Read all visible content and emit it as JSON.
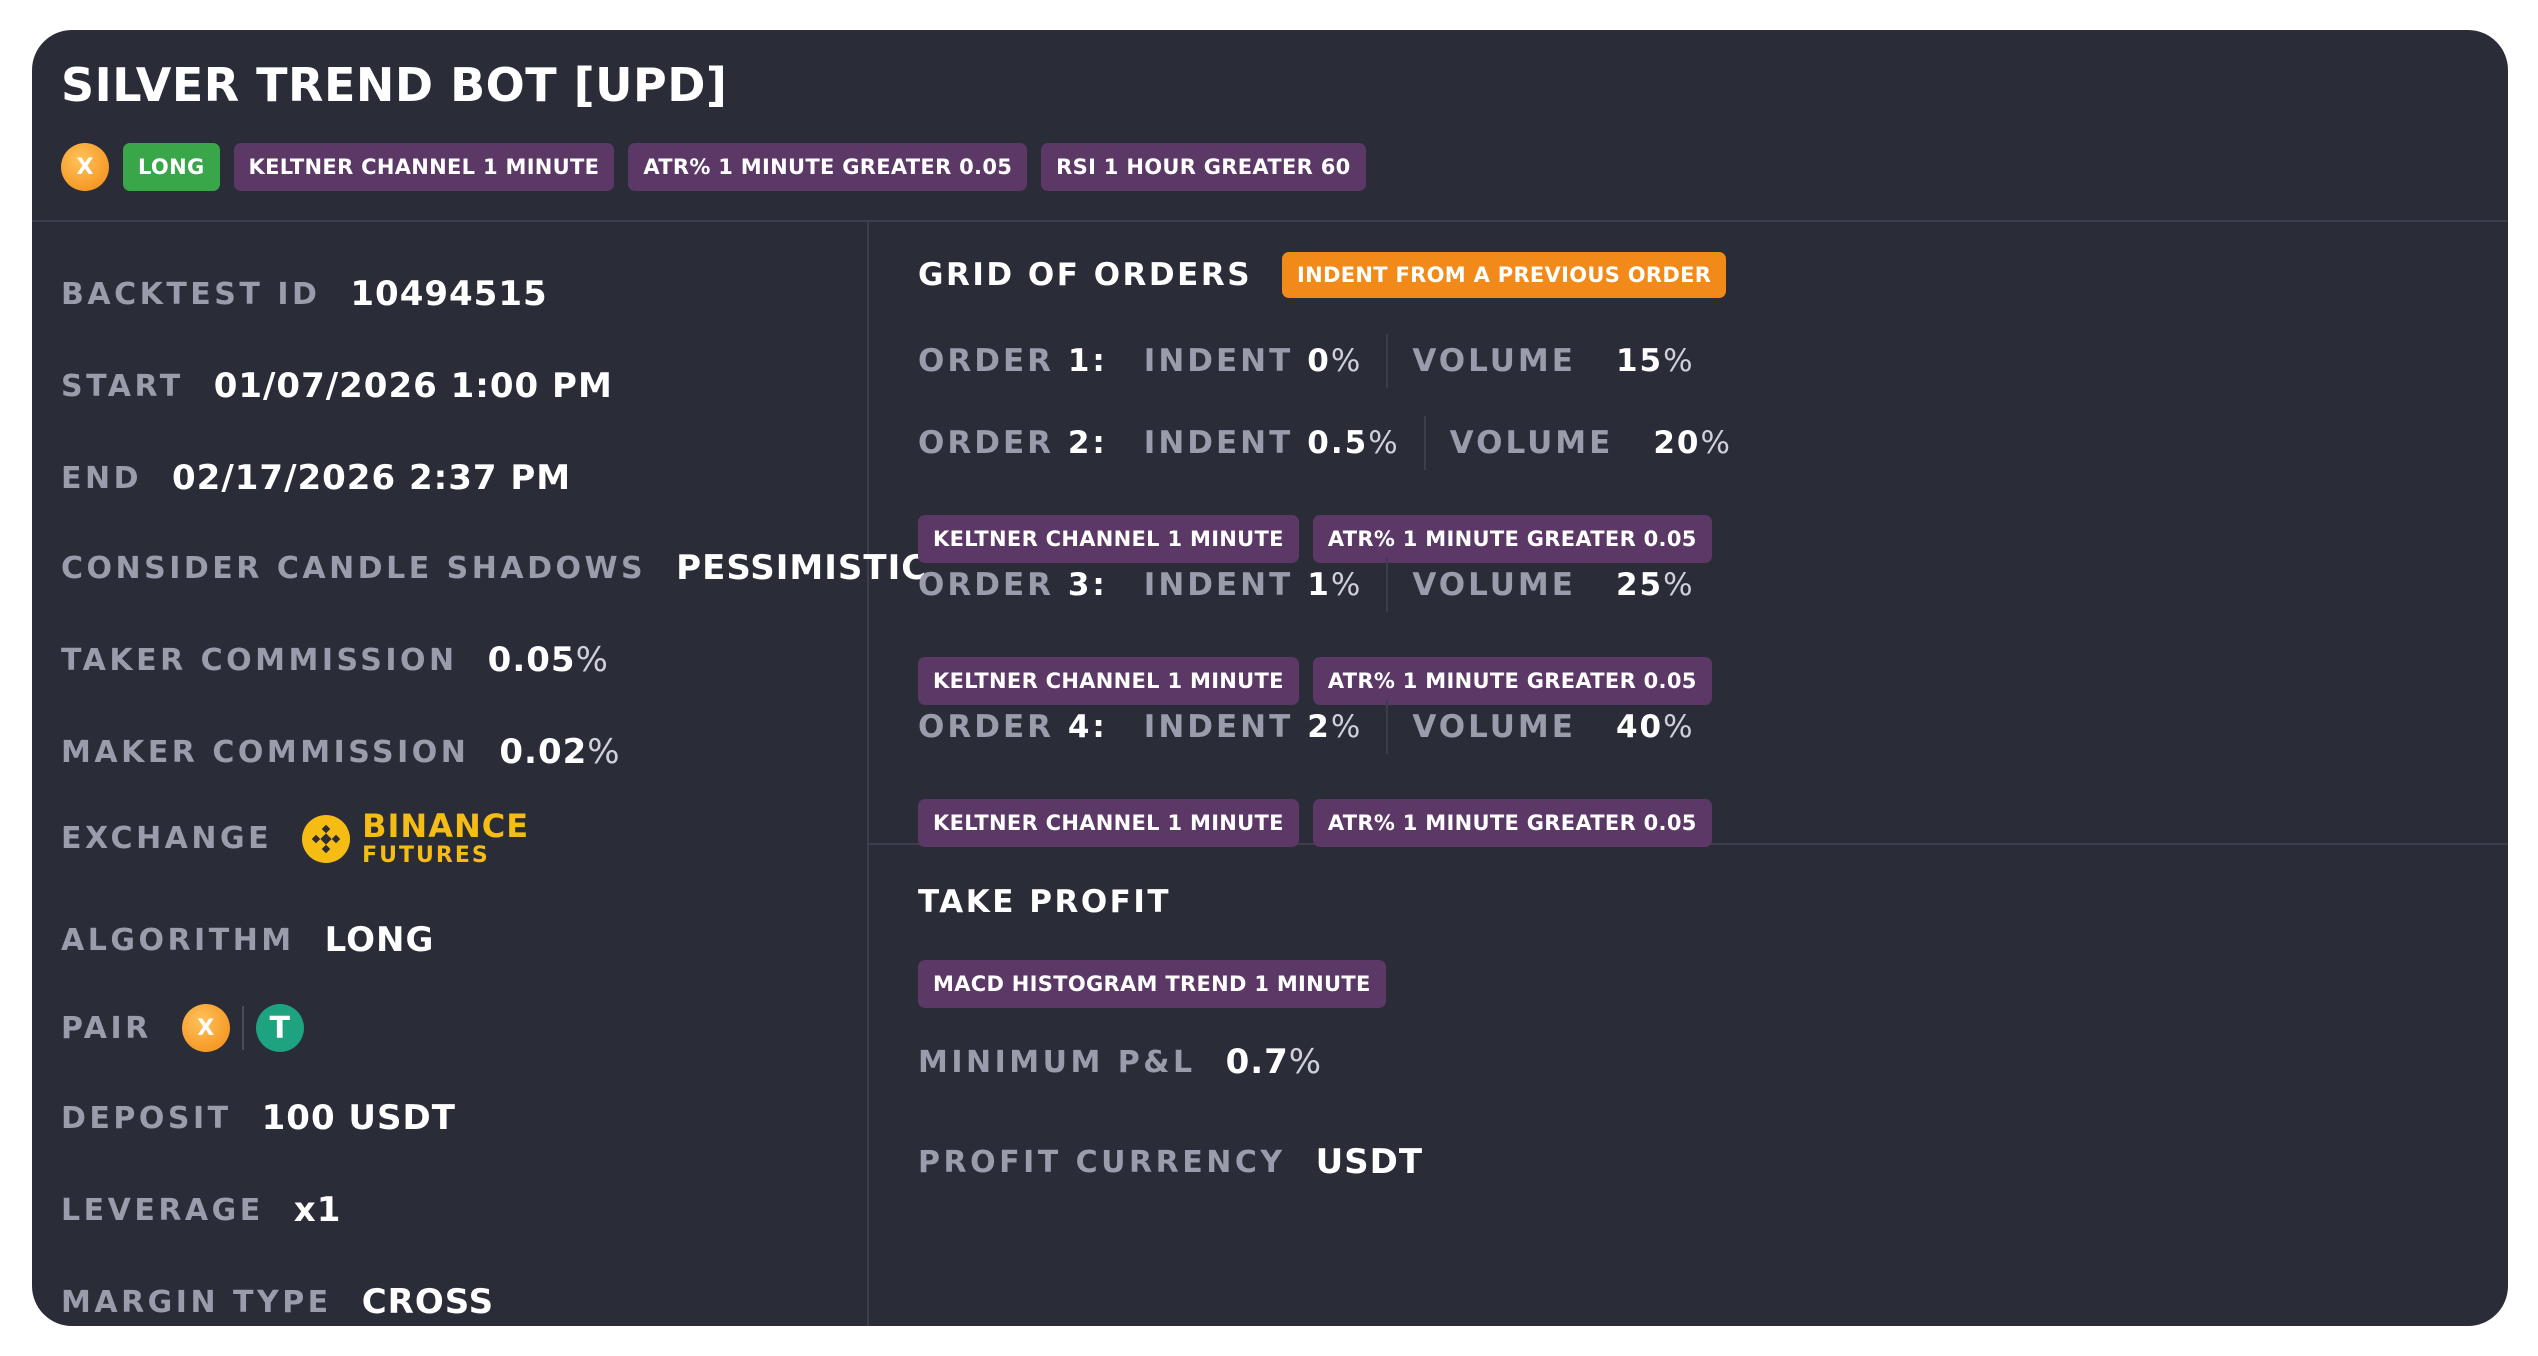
{
  "title": "SILVER TREND BOT [UPD]",
  "header_tags": {
    "coin_symbol": "X",
    "direction": "LONG",
    "filters": [
      "KELTNER CHANNEL 1 MINUTE",
      "ATR% 1 MINUTE GREATER 0.05",
      "RSI 1 HOUR GREATER 60"
    ]
  },
  "details": {
    "backtest_id": {
      "label": "BACKTEST ID",
      "value": "10494515"
    },
    "start": {
      "label": "START",
      "value": "01/07/2026 1:00 PM"
    },
    "end": {
      "label": "END",
      "value": "02/17/2026 2:37 PM"
    },
    "candle_shadows": {
      "label": "CONSIDER CANDLE SHADOWS",
      "value": "PESSIMISTIC"
    },
    "taker": {
      "label": "TAKER COMMISSION",
      "value": "0.05",
      "unit": "%"
    },
    "maker": {
      "label": "MAKER COMMISSION",
      "value": "0.02",
      "unit": "%"
    },
    "exchange": {
      "label": "EXCHANGE",
      "name": "BINANCE",
      "sub": "FUTURES"
    },
    "algorithm": {
      "label": "ALGORITHM",
      "value": "LONG"
    },
    "pair": {
      "label": "PAIR",
      "base": "X",
      "quote": "T"
    },
    "deposit": {
      "label": "DEPOSIT",
      "value": "100 USDT"
    },
    "leverage": {
      "label": "LEVERAGE",
      "value": "x1"
    },
    "margin": {
      "label": "MARGIN TYPE",
      "value": "CROSS"
    }
  },
  "grid": {
    "title": "GRID OF ORDERS",
    "mode": "INDENT FROM A PREVIOUS ORDER",
    "indent_label": "INDENT",
    "volume_label": "VOLUME",
    "orders": [
      {
        "label": "ORDER",
        "num": "1:",
        "indent": "0",
        "volume": "15",
        "unit": "%",
        "tags": []
      },
      {
        "label": "ORDER",
        "num": "2:",
        "indent": "0.5",
        "volume": "20",
        "unit": "%",
        "tags": [
          "KELTNER CHANNEL 1 MINUTE",
          "ATR% 1 MINUTE GREATER 0.05"
        ]
      },
      {
        "label": "ORDER",
        "num": "3:",
        "indent": "1",
        "volume": "25",
        "unit": "%",
        "tags": [
          "KELTNER CHANNEL 1 MINUTE",
          "ATR% 1 MINUTE GREATER 0.05"
        ]
      },
      {
        "label": "ORDER",
        "num": "4:",
        "indent": "2",
        "volume": "40",
        "unit": "%",
        "tags": [
          "KELTNER CHANNEL 1 MINUTE",
          "ATR% 1 MINUTE GREATER 0.05"
        ]
      }
    ]
  },
  "take_profit": {
    "title": "TAKE PROFIT",
    "tag": "MACD HISTOGRAM TREND 1 MINUTE",
    "min_pnl": {
      "label": "MINIMUM P&L",
      "value": "0.7",
      "unit": "%"
    },
    "currency": {
      "label": "PROFIT CURRENCY",
      "value": "USDT"
    }
  },
  "colors": {
    "card_bg": "#2a2c38",
    "long_tag": "#3aa64a",
    "filter_tag": "#5c3866",
    "mode_tag": "#f18a18",
    "binance": "#f5bd14",
    "tether": "#1ea380"
  }
}
